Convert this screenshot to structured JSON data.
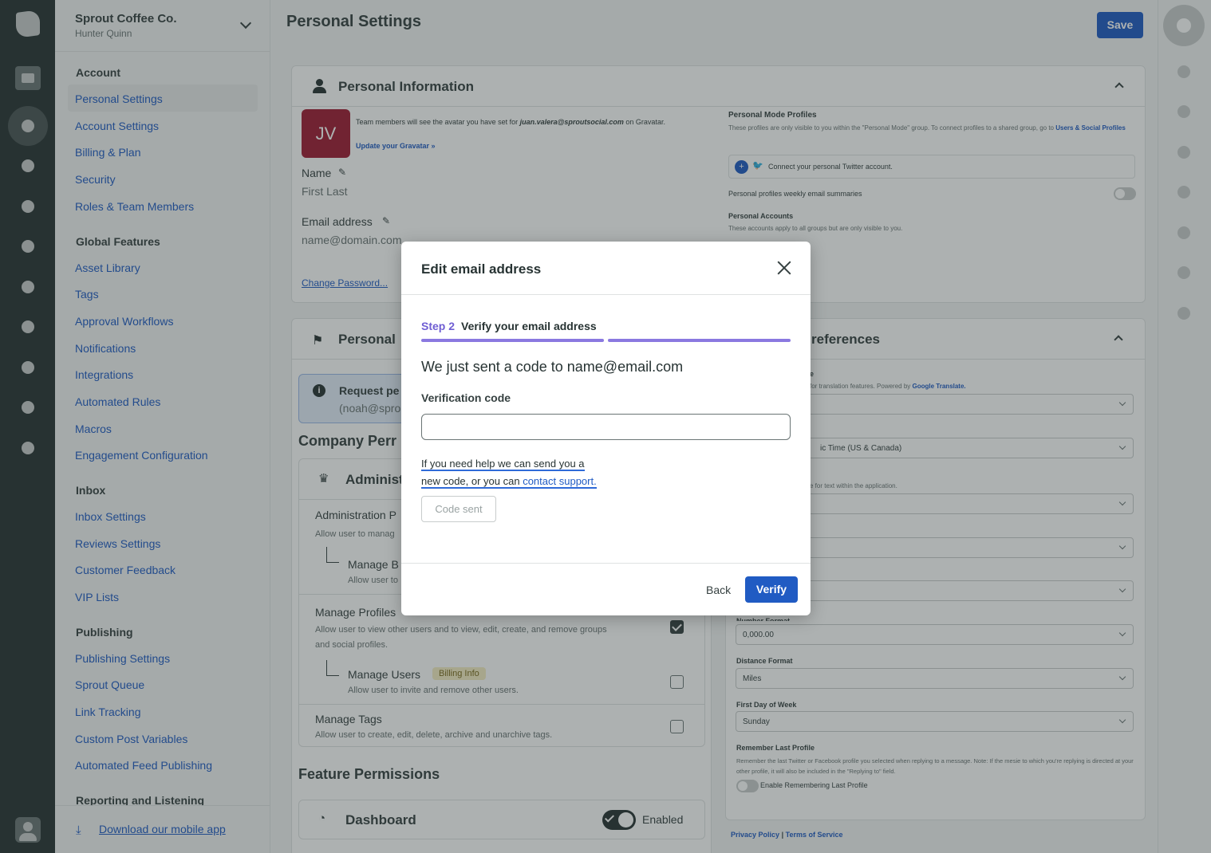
{
  "colors": {
    "rail": "#273333",
    "accent": "#205bc3",
    "purple": "#6f5ed3",
    "avatar": "#9e1b32"
  },
  "sidebar": {
    "org": "Sprout Coffee Co.",
    "user": "Hunter Quinn",
    "sections": [
      {
        "title": "Account",
        "items": [
          "Personal Settings",
          "Account Settings",
          "Billing & Plan",
          "Security",
          "Roles & Team Members"
        ]
      },
      {
        "title": "Global Features",
        "items": [
          "Asset Library",
          "Tags",
          "Approval Workflows",
          "Notifications",
          "Integrations",
          "Automated Rules",
          "Macros",
          "Engagement Configuration"
        ]
      },
      {
        "title": "Inbox",
        "items": [
          "Inbox Settings",
          "Reviews Settings",
          "Customer Feedback",
          "VIP Lists"
        ]
      },
      {
        "title": "Publishing",
        "items": [
          "Publishing Settings",
          "Sprout Queue",
          "Link Tracking",
          "Custom Post Variables",
          "Automated Feed Publishing"
        ]
      },
      {
        "title": "Reporting and Listening",
        "items": []
      }
    ],
    "download": "Download our mobile app"
  },
  "header": {
    "title": "Personal Settings",
    "save": "Save"
  },
  "personal_info": {
    "title": "Personal Information",
    "avatar_initials": "JV",
    "avatar_note_1": "Team members will see the avatar you have set for ",
    "avatar_email": "juan.valera@sproutsocial.com",
    "avatar_note_2": " on Gravatar.",
    "gravatar_link": "Update your Gravatar »",
    "name_label": "Name",
    "name_value": "First Last",
    "email_label": "Email address",
    "email_value": "name@domain.com",
    "change_password": "Change Password...",
    "pmp_title": "Personal Mode Profiles",
    "pmp_desc": "These profiles are only visible to you within the \"Personal Mode\" group. To connect profiles to a shared group, go to ",
    "pmp_link": "Users & Social Profiles",
    "connect_twitter": "Connect your personal Twitter account.",
    "weekly": "Personal profiles weekly email summaries",
    "accounts_title": "Personal Accounts",
    "accounts_desc": "These accounts apply to all groups but are only visible to you."
  },
  "permissions": {
    "card_title_left": "Personal",
    "request_title": "Request pe",
    "request_sub": "(noah@spro",
    "company_title": "Company Perr",
    "admin_title": "Administ",
    "admin_row_title": "Administration P",
    "admin_row_desc": "Allow user to manag",
    "manage_b": "Manage B",
    "manage_b_desc": "Allow user to",
    "manage_profiles": "Manage Profiles",
    "manage_profiles_desc": "Allow user to view other users and to view, edit, create, and remove groups and social profiles.",
    "manage_users": "Manage Users",
    "billing_badge": "Billing Info",
    "manage_users_desc": "Allow user to invite and remove other users.",
    "manage_tags": "Manage Tags",
    "manage_tags_desc": "Allow user to create, edit, delete, archive and unarchive tags.",
    "feature_title": "Feature Permissions",
    "dashboard": "Dashboard",
    "enabled": "Enabled"
  },
  "preferences": {
    "title_partial": "references",
    "lang_label_partial": "e",
    "lang_desc_partial": "for translation features. Powered by ",
    "google_translate": "Google Translate.",
    "tz_value_partial": "ic Time (US & Canada)",
    "text_desc_partial": "e for text within the application.",
    "number_format_label": "Number Format",
    "number_format_value": "0,000.00",
    "distance_label": "Distance Format",
    "distance_value": "Miles",
    "first_day_label": "First Day of Week",
    "first_day_value": "Sunday",
    "remember_label": "Remember Last Profile",
    "remember_desc": "Remember the last Twitter or Facebook profile you selected when replying to a message. Note: If the mesie to which you're replying is directed at your other profile, it will also be included in the \"Replying to\" field.",
    "remember_toggle": "Enable Remembering Last Profile",
    "privacy": "Privacy Policy",
    "sep": "|",
    "terms": "Terms of Service"
  },
  "modal": {
    "title": "Edit email address",
    "step_num": "Step 2",
    "step_title": "Verify your email address",
    "sent": "We just sent a code to name@email.com",
    "code_label": "Verification code",
    "code_value": "",
    "help_1": "If you need help we can send you a",
    "help_2": "new code, or you can ",
    "help_link": "contact support.",
    "code_sent": "Code sent",
    "back": "Back",
    "verify": "Verify"
  }
}
